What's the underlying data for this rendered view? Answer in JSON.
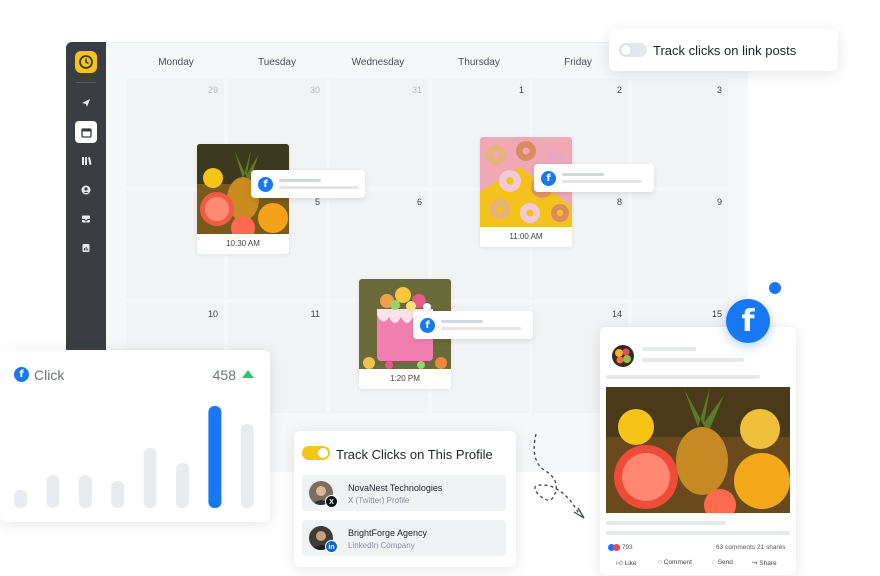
{
  "calendar": {
    "days": [
      "Monday",
      "Tuesday",
      "Wednesday",
      "Thursday",
      "Friday"
    ],
    "weeks": [
      [
        "29",
        "30",
        "31",
        "1",
        "2",
        "3"
      ],
      [
        "",
        "5",
        "6",
        "",
        "8",
        "9"
      ],
      [
        "10",
        "11",
        "",
        "",
        "14",
        "15"
      ]
    ]
  },
  "posts": [
    {
      "time": "10:30 AM"
    },
    {
      "time": "11:00 AM"
    },
    {
      "time": "1:20 PM"
    }
  ],
  "link_toggle": {
    "label": "Track clicks on link posts",
    "on": false
  },
  "clicks": {
    "label": "Click",
    "count": "458",
    "trend": "up"
  },
  "chart_data": {
    "type": "bar",
    "values": [
      0.12,
      0.22,
      0.22,
      0.18,
      0.4,
      0.3,
      0.68,
      0.56
    ],
    "highlight_index": 6,
    "colors": {
      "default": "#e9ebee",
      "highlight": "#1877f2"
    }
  },
  "profile_tracking": {
    "label": "Track Clicks on This Profile",
    "on": true,
    "accounts": [
      {
        "name": "NovaNest Technologies",
        "type": "X (Twitter) Profile",
        "network_icon": "x-icon"
      },
      {
        "name": "BrightForge Agency",
        "type": "LinkedIn Company",
        "network_icon": "linkedin-icon"
      }
    ]
  },
  "preview": {
    "reactions": "793",
    "comments": "63 comments",
    "shares": "21 shares",
    "actions": [
      "Like",
      "Comment",
      "Send",
      "Share"
    ]
  },
  "colors": {
    "brand": "#1877f2",
    "accent": "#f5c518",
    "toggle_on": "#f5c518",
    "toggle_off": "#e5e7eb",
    "up": "#31c46a"
  }
}
